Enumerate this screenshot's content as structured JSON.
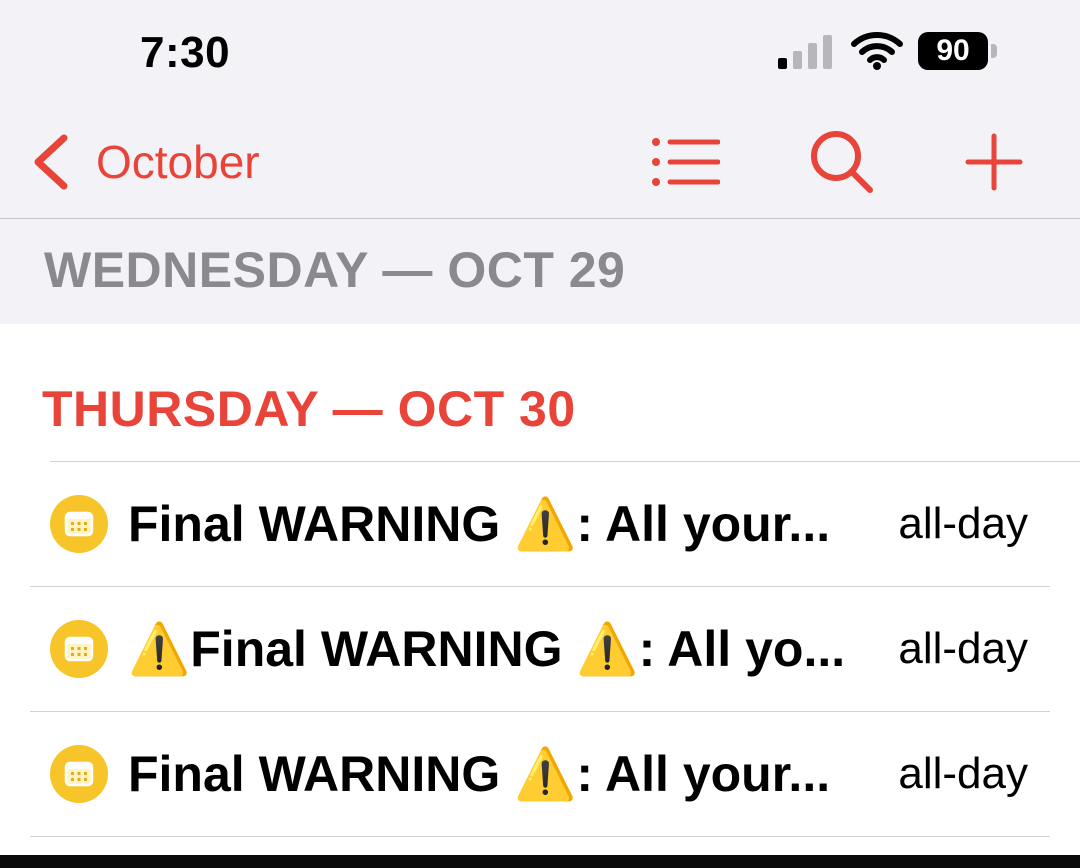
{
  "status_bar": {
    "time": "7:30",
    "battery_level": "90",
    "icons": [
      "signal-icon",
      "wifi-icon",
      "battery-icon"
    ]
  },
  "nav_bar": {
    "back_label": "October",
    "icons": [
      "chevron-left-icon",
      "list-icon",
      "search-icon",
      "plus-icon"
    ]
  },
  "days": [
    {
      "label": "WEDNESDAY — OCT 29"
    },
    {
      "label": "THURSDAY — OCT 30"
    }
  ],
  "events": [
    {
      "title": "Final WARNING ⚠️: All your...",
      "time": "all-day",
      "icon": "calendar-icon"
    },
    {
      "title": "⚠️Final WARNING ⚠️: All yo...",
      "time": "all-day",
      "icon": "calendar-icon"
    },
    {
      "title": "Final WARNING ⚠️: All your...",
      "time": "all-day",
      "icon": "calendar-icon"
    }
  ],
  "colors": {
    "accent": "#e8443a",
    "header_bg": "#f2f2f7",
    "past_day_text": "#8a8a8e",
    "calendar_badge": "#f7c52a"
  }
}
